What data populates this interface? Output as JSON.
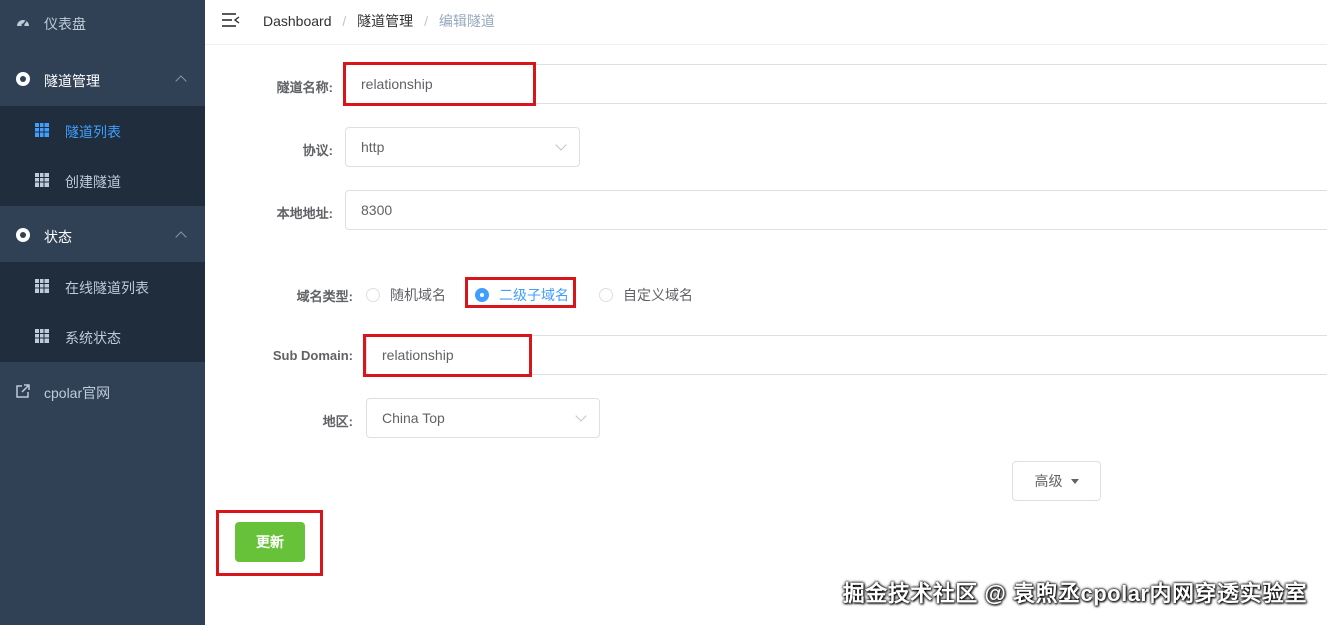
{
  "sidebar": {
    "dashboard": "仪表盘",
    "tunnel_mgmt": "隧道管理",
    "tunnel_list": "隧道列表",
    "create_tunnel": "创建隧道",
    "status": "状态",
    "online_tunnels": "在线隧道列表",
    "system_status": "系统状态",
    "cpolar_site": "cpolar官网"
  },
  "breadcrumb": {
    "home": "Dashboard",
    "sep": "/",
    "section": "隧道管理",
    "current": "编辑隧道"
  },
  "form": {
    "name_label": "隧道名称:",
    "name_value": "relationship",
    "protocol_label": "协议:",
    "protocol_value": "http",
    "local_label": "本地地址:",
    "local_value": "8300",
    "domain_type_label": "域名类型:",
    "domain_types": [
      "随机域名",
      "二级子域名",
      "自定义域名"
    ],
    "subdomain_label": "Sub Domain:",
    "subdomain_value": "relationship",
    "region_label": "地区:",
    "region_value": "China Top",
    "advanced": "高级",
    "update": "更新"
  },
  "watermark": "掘金技术社区 @ 袁煦丞cpolar内网穿透实验室",
  "colors": {
    "sidebar_bg": "#304156",
    "submenu_bg": "#1f2d3d",
    "accent": "#409eff",
    "update_green": "#67c23a",
    "highlight_red": "#d7151b"
  }
}
